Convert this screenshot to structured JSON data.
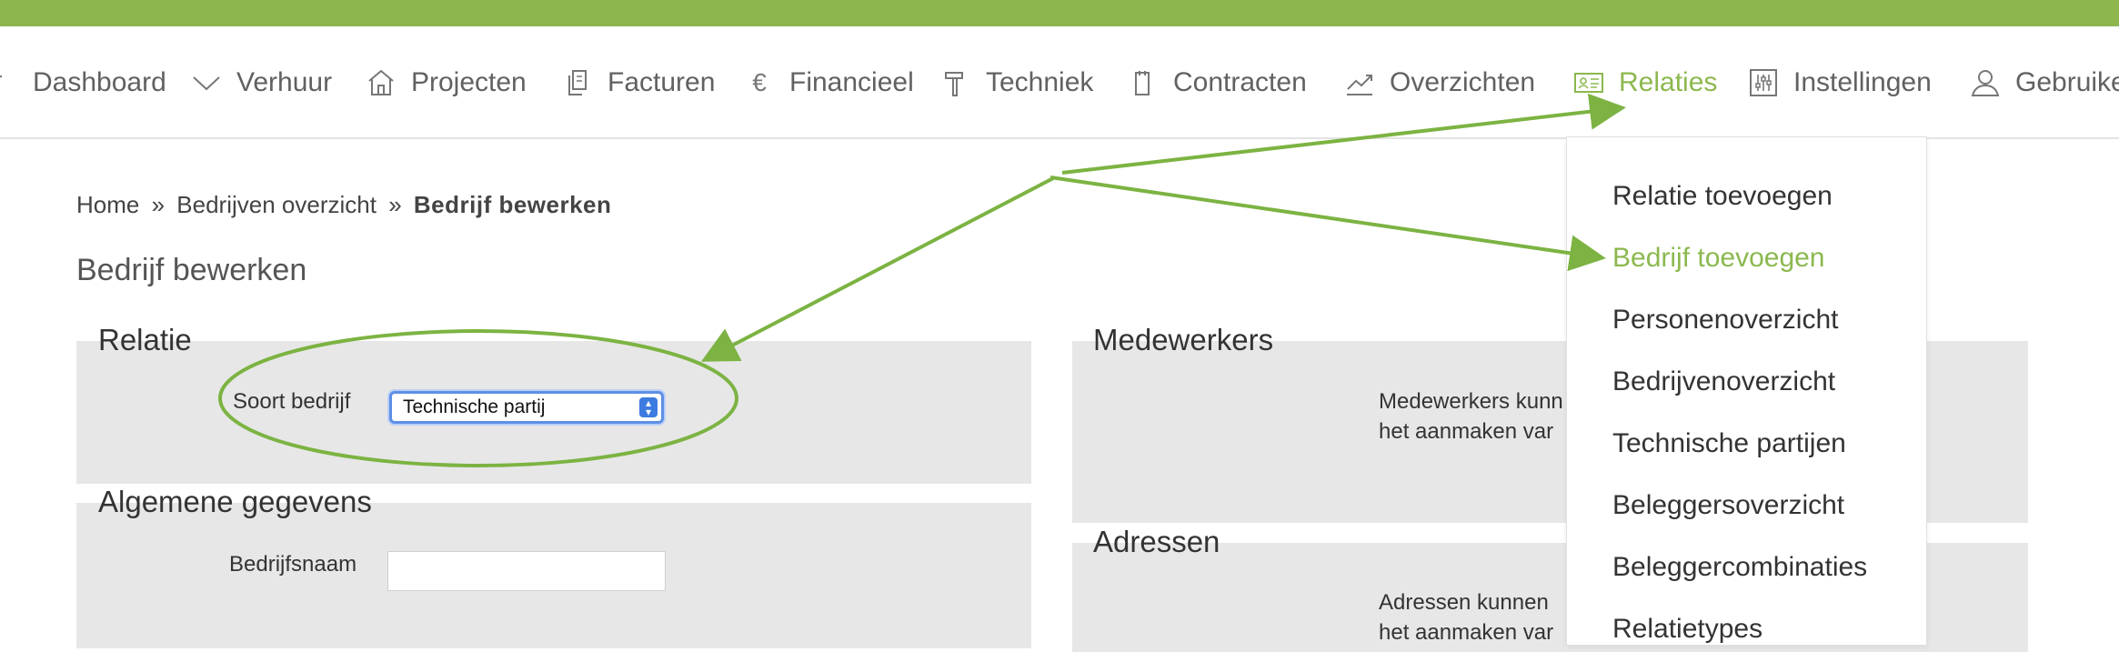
{
  "colors": {
    "accent": "#8cb84f",
    "topbar": "#8db64f",
    "panel": "#e7e7e7",
    "select_focus": "#5e8fe6"
  },
  "nav": {
    "items": [
      {
        "label": "Dashboard",
        "icon": "partial-icon"
      },
      {
        "label": "Verhuur",
        "icon": "chevron-down-icon"
      },
      {
        "label": "Projecten",
        "icon": "home-icon"
      },
      {
        "label": "Facturen",
        "icon": "documents-icon"
      },
      {
        "label": "Financieel",
        "icon": "euro-icon"
      },
      {
        "label": "Techniek",
        "icon": "hammer-icon"
      },
      {
        "label": "Contracten",
        "icon": "contract-icon"
      },
      {
        "label": "Overzichten",
        "icon": "line-chart-icon"
      },
      {
        "label": "Relaties",
        "icon": "contact-card-icon",
        "active": true
      },
      {
        "label": "Instellingen",
        "icon": "sliders-icon"
      },
      {
        "label": "Gebruike",
        "icon": "user-icon"
      }
    ]
  },
  "breadcrumb": {
    "home": "Home",
    "separator": "»",
    "overview": "Bedrijven overzicht",
    "current": "Bedrijf bewerken"
  },
  "page": {
    "title": "Bedrijf bewerken"
  },
  "relatie": {
    "title": "Relatie",
    "soort_label": "Soort bedrijf",
    "soort_value": "Technische partij"
  },
  "algemeen": {
    "title": "Algemene gegevens",
    "bedrijfsnaam_label": "Bedrijfsnaam",
    "bedrijfsnaam_value": ""
  },
  "medewerkers": {
    "title": "Medewerkers",
    "line1": "Medewerkers kunn",
    "line2": "het aanmaken var"
  },
  "adressen": {
    "title": "Adressen",
    "line1": "Adressen kunnen",
    "line2": "het aanmaken var"
  },
  "dropdown": {
    "items": [
      {
        "label": "Relatie toevoegen"
      },
      {
        "label": "Bedrijf toevoegen",
        "active": true
      },
      {
        "label": "Personenoverzicht"
      },
      {
        "label": "Bedrijvenoverzicht"
      },
      {
        "label": "Technische partijen"
      },
      {
        "label": "Beleggersoverzicht"
      },
      {
        "label": "Beleggercombinaties"
      },
      {
        "label": "Relatietypes"
      }
    ]
  }
}
